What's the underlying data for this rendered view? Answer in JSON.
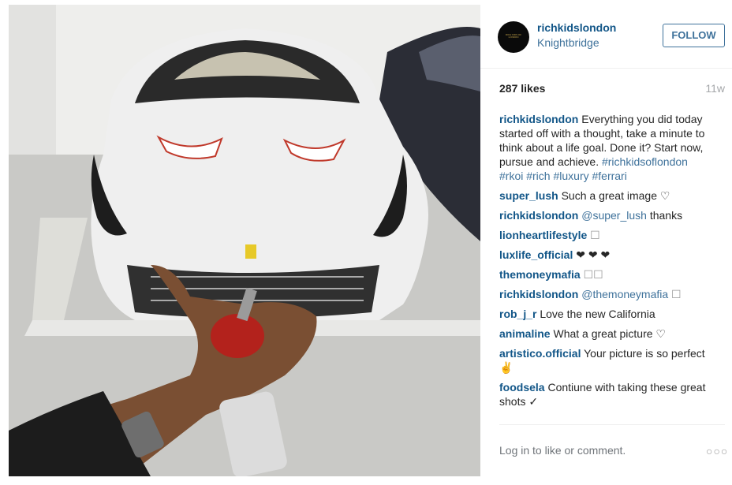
{
  "post": {
    "username": "richkidslondon",
    "location": "Knightbridge",
    "follow_label": "FOLLOW",
    "likes": "287 likes",
    "age": "11w",
    "avatar_text": "RICH KIDS OF LONDON",
    "caption": {
      "user": "richkidslondon",
      "text": " Everything you did today started off with a thought, take a minute to think about a life goal. Done it? Start now, pursue and achieve. ",
      "hashtags": "#richkidsoflondon #rkoi #rich #luxury #ferrari"
    },
    "comments": [
      {
        "user": "super_lush",
        "text": " Such a great image ♡"
      },
      {
        "user": "richkidslondon",
        "mention": " @super_lush",
        "text": " thanks"
      },
      {
        "user": "lionheartlifestyle",
        "text": " ☐"
      },
      {
        "user": "luxlife_official",
        "text": " ❤ ❤ ❤"
      },
      {
        "user": "themoneymafia",
        "text": " ☐☐"
      },
      {
        "user": "richkidslondon",
        "mention": " @themoneymafia",
        "text": " ☐"
      },
      {
        "user": "rob_j_r",
        "text": " Love the new California"
      },
      {
        "user": "animaline",
        "text": " What a great picture ♡"
      },
      {
        "user": "artistico.official",
        "text": " Your picture is so perfect ✌"
      },
      {
        "user": "foodsela",
        "text": " Contiune with taking these great shots ✓"
      }
    ],
    "login_prompt": "Log in to like or comment.",
    "more_label": "○○○"
  }
}
